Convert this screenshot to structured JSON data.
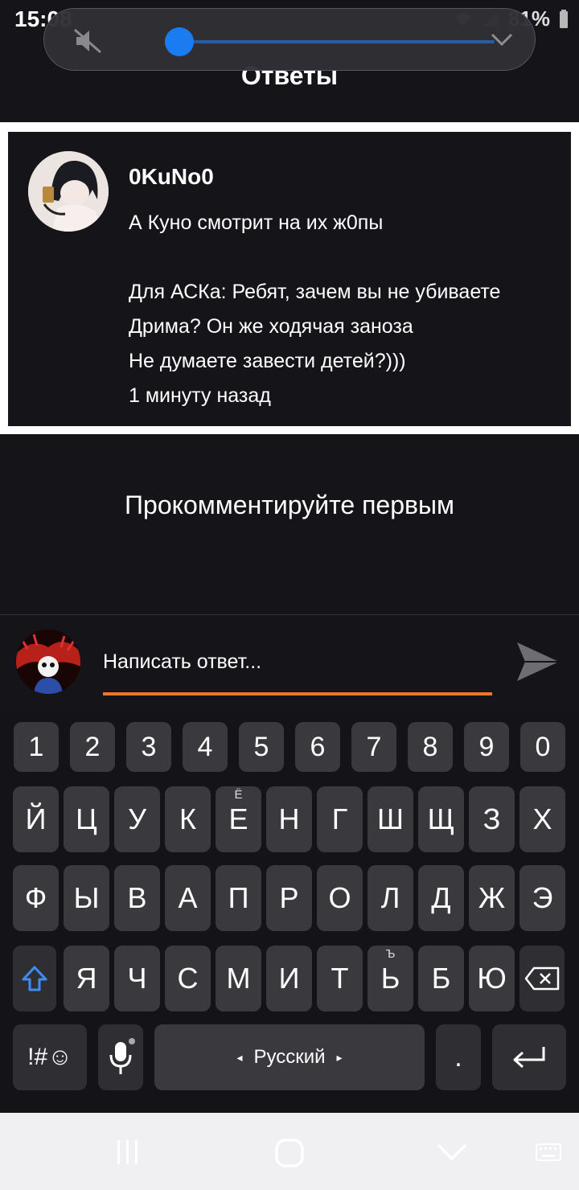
{
  "status_bar": {
    "time": "15:08",
    "battery": "81%"
  },
  "volume_panel": {
    "level": 0.04
  },
  "header": {
    "title": "Ответы"
  },
  "post": {
    "author": "0KuNo0",
    "lines": [
      "А Куно смотрит на их ж0пы",
      "",
      "Для АСКа: Ребят, зачем вы не убиваете",
      "Дрима? Он же ходячая заноза",
      "Не думаете завести детей?)))"
    ],
    "timestamp": "1 минуту назад"
  },
  "comments": {
    "empty_text": "Прокомментируйте первым"
  },
  "reply": {
    "placeholder": "Написать ответ..."
  },
  "keyboard": {
    "numbers": [
      "1",
      "2",
      "3",
      "4",
      "5",
      "6",
      "7",
      "8",
      "9",
      "0"
    ],
    "row1": [
      "Й",
      "Ц",
      "У",
      "К",
      "Е",
      "Н",
      "Г",
      "Ш",
      "Щ",
      "З",
      "Х"
    ],
    "row1_sub": {
      "Е": "Ё"
    },
    "row2": [
      "Ф",
      "Ы",
      "В",
      "А",
      "П",
      "Р",
      "О",
      "Л",
      "Д",
      "Ж",
      "Э"
    ],
    "row3": [
      "Я",
      "Ч",
      "С",
      "М",
      "И",
      "Т",
      "Ь",
      "Б",
      "Ю"
    ],
    "row3_sub": {
      "Ь": "Ъ"
    },
    "symbols_label": "!#☺",
    "space_label": "Русский",
    "period_label": "."
  },
  "colors": {
    "background": "#151419",
    "accent_orange": "#f07332",
    "volume_blue": "#1a7cf0",
    "key": "#3a3a3e",
    "shift_blue": "#3d8ef0"
  }
}
